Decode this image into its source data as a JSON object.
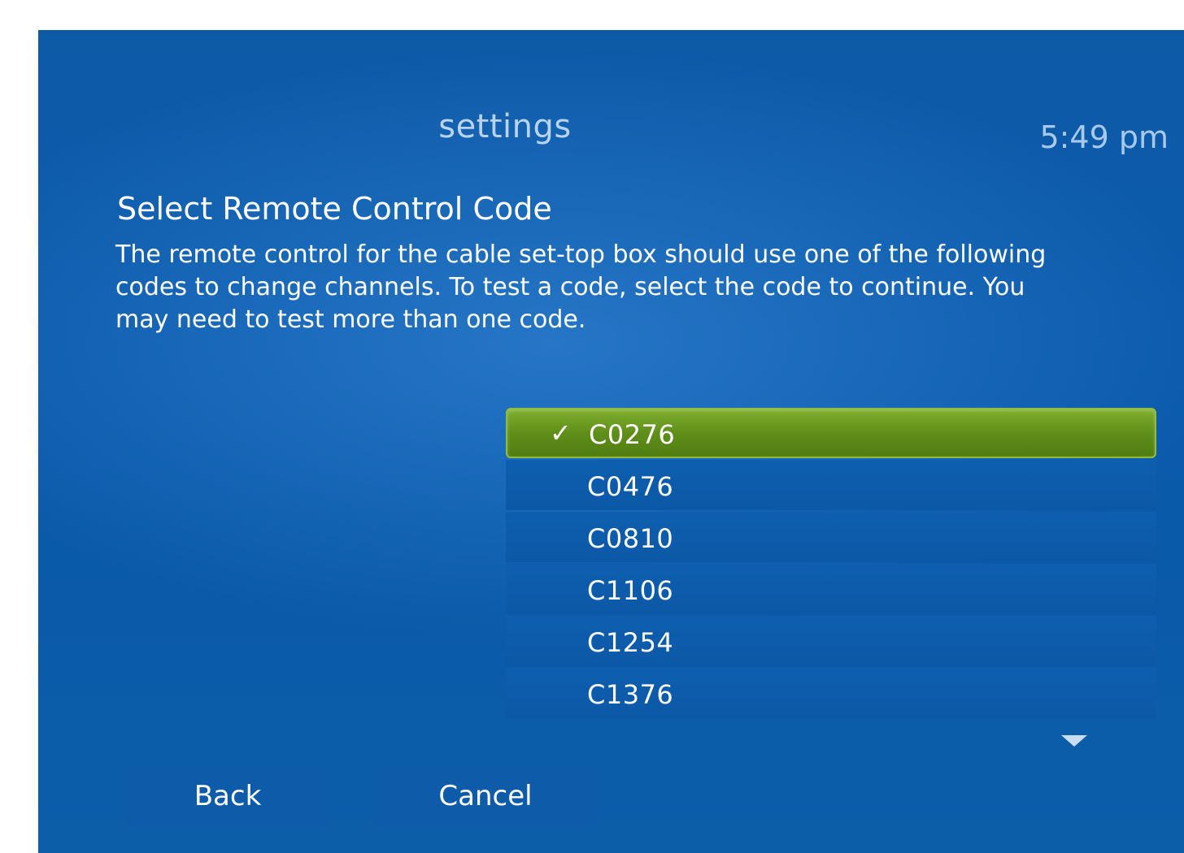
{
  "header": {
    "title": "settings",
    "clock": "5:49 pm"
  },
  "page": {
    "heading": "Select Remote Control Code",
    "description": "The remote control for the cable set-top box should use one of the following codes to change channels. To test a code, select the code to continue. You may need to test more than one code."
  },
  "code_list": {
    "items": [
      {
        "code": "C0276",
        "selected": true
      },
      {
        "code": "C0476",
        "selected": false
      },
      {
        "code": "C0810",
        "selected": false
      },
      {
        "code": "C1106",
        "selected": false
      },
      {
        "code": "C1254",
        "selected": false
      },
      {
        "code": "C1376",
        "selected": false
      }
    ],
    "check_glyph": "✓",
    "scroll_icon": "triangle-down-icon"
  },
  "buttons": {
    "back": "Back",
    "cancel": "Cancel"
  },
  "colors": {
    "background": "#0b5aab",
    "selected": "#6a9a22",
    "header_text": "#b7d3ee"
  }
}
